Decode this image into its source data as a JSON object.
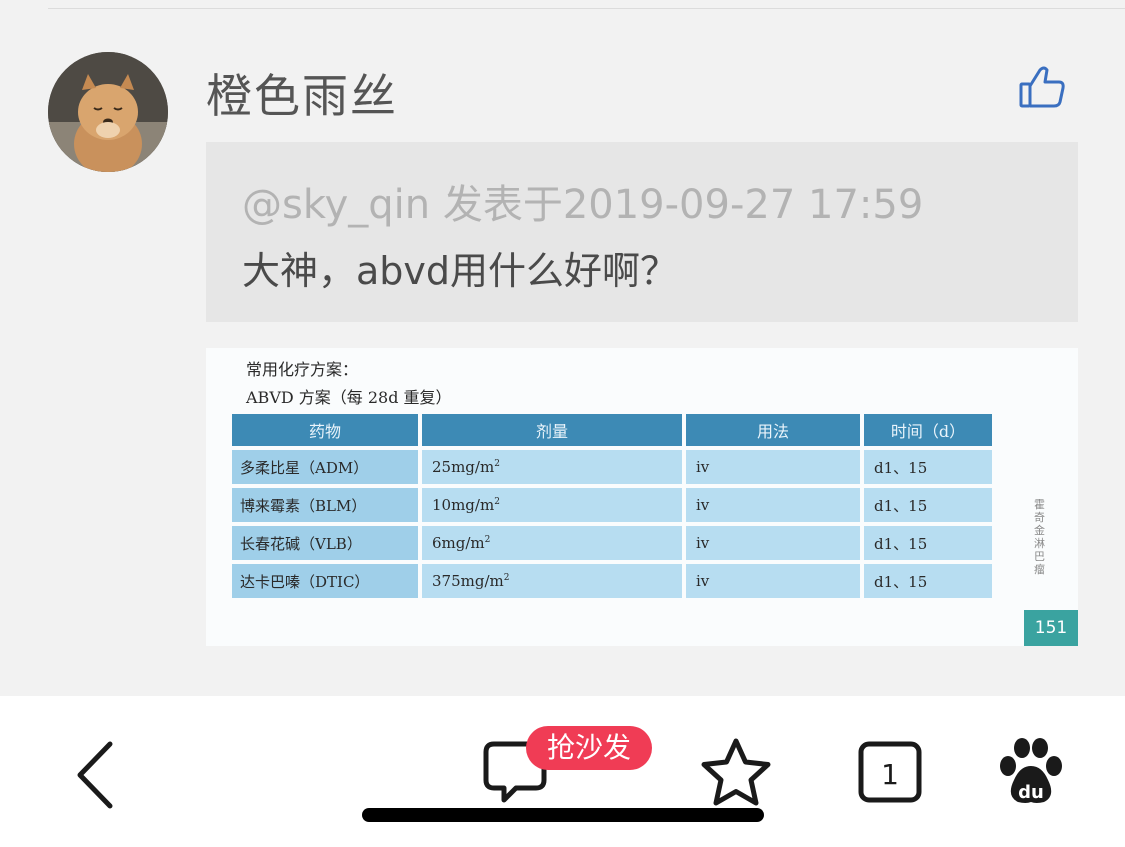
{
  "post": {
    "username": "橙色雨丝",
    "quote_meta": "@sky_qin 发表于2019-09-27 17:59",
    "quote_text": "大神，abvd用什么好啊？"
  },
  "image": {
    "caption_1": "常用化疗方案：",
    "caption_2": "ABVD 方案（每 28d 重复）",
    "headers": [
      "药物",
      "剂量",
      "用法",
      "时间（d）"
    ],
    "rows": [
      {
        "drug": "多柔比星（ADM）",
        "dose": "25mg/m",
        "route": "iv",
        "time": "d1、15"
      },
      {
        "drug": "博来霉素（BLM）",
        "dose": "10mg/m",
        "route": "iv",
        "time": "d1、15"
      },
      {
        "drug": "长春花碱（VLB）",
        "dose": "6mg/m",
        "route": "iv",
        "time": "d1、15"
      },
      {
        "drug": "达卡巴嗪（DTIC）",
        "dose": "375mg/m",
        "route": "iv",
        "time": "d1、15"
      }
    ],
    "dose_exponent": "2",
    "side_label": "霍奇金淋巴瘤",
    "page_number": "151"
  },
  "bottom_bar": {
    "sofa_badge": "抢沙发",
    "tab_count": "1",
    "baidu_text": "du"
  },
  "colors": {
    "accent_red": "#f03c55",
    "like_blue": "#3a6fc0",
    "table_header": "#3d8ab5",
    "page_badge": "#3aa3a0"
  },
  "icons": [
    "avatar",
    "thumbs-up-icon",
    "back-arrow-icon",
    "comment-icon",
    "star-icon",
    "tabs-icon",
    "baidu-paw-icon"
  ]
}
